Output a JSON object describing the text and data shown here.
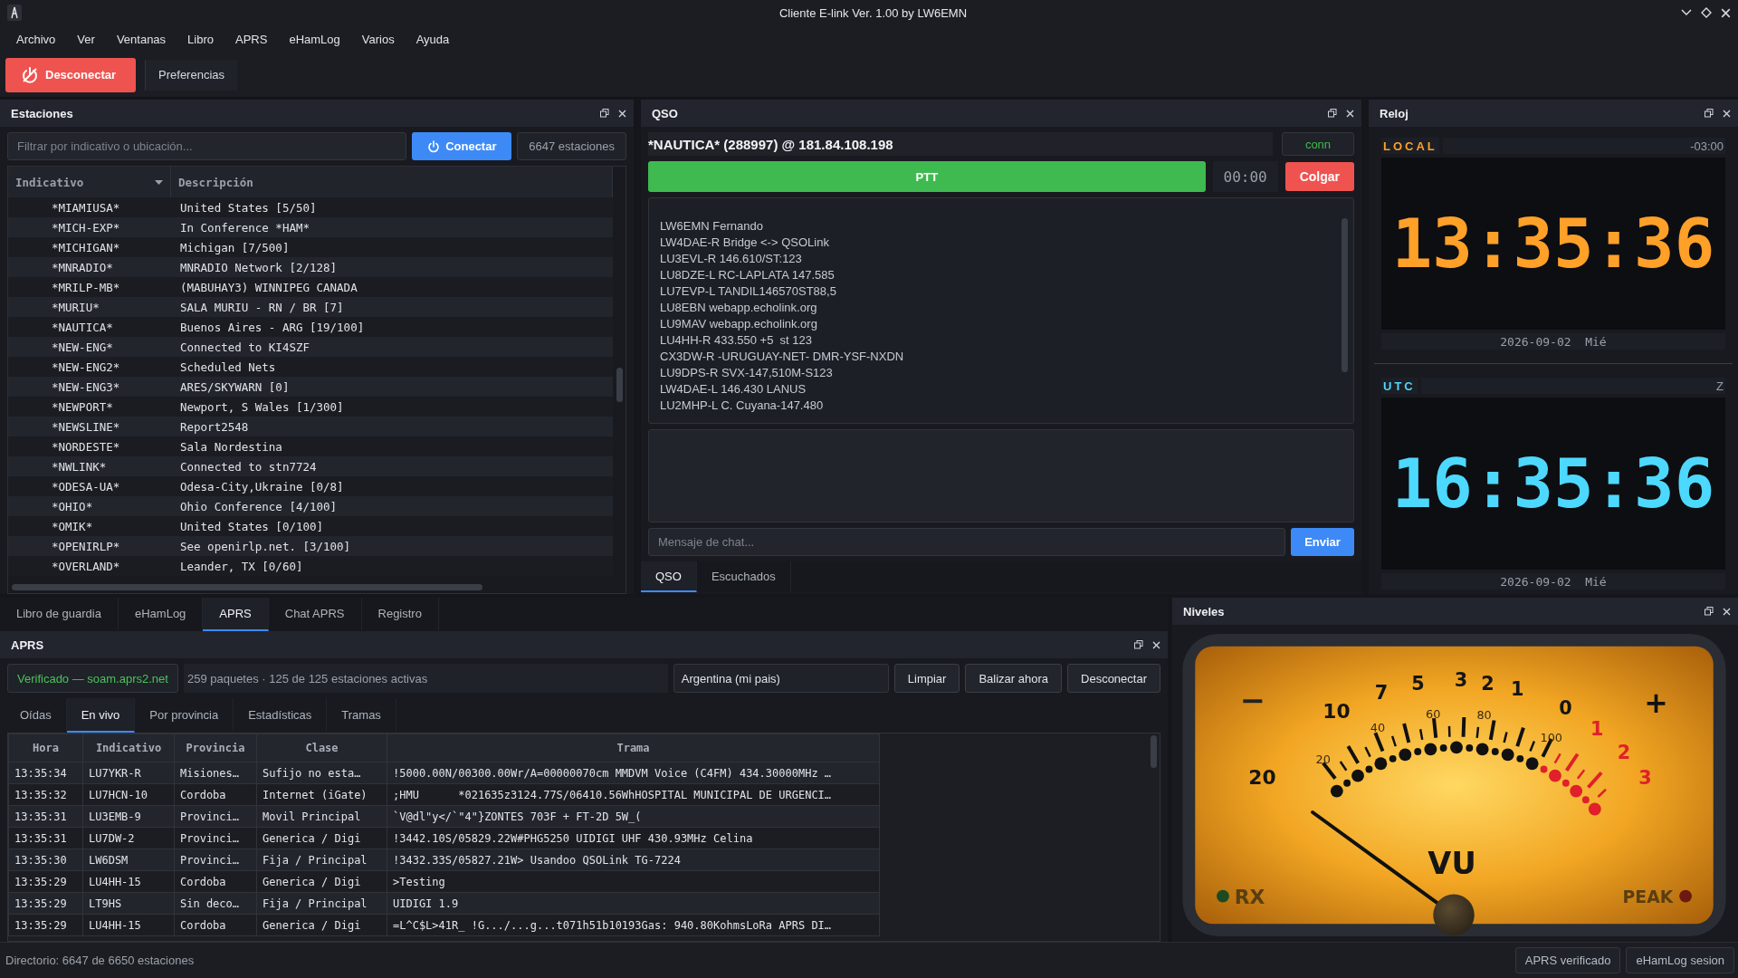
{
  "window": {
    "title": "Cliente E-link Ver. 1.00 by LW6EMN"
  },
  "menu": [
    "Archivo",
    "Ver",
    "Ventanas",
    "Libro",
    "APRS",
    "eHamLog",
    "Varios",
    "Ayuda"
  ],
  "toolbar": {
    "disconnect": "Desconectar",
    "preferences": "Preferencias"
  },
  "stations": {
    "title": "Estaciones",
    "filter_placeholder": "Filtrar por indicativo o ubicación...",
    "connect": "Conectar",
    "count": "6647 estaciones",
    "columns": [
      "Indicativo",
      "Descripción"
    ],
    "rows": [
      {
        "callsign": "*MIAMIUSA*",
        "description": "United States [5/50]"
      },
      {
        "callsign": "*MICH-EXP*",
        "description": "In Conference *HAM*"
      },
      {
        "callsign": "*MICHIGAN*",
        "description": "Michigan [7/500]"
      },
      {
        "callsign": "*MNRADIO*",
        "description": "MNRADIO Network [2/128]"
      },
      {
        "callsign": "*MRILP-MB*",
        "description": "(MABUHAY3) WINNIPEG CANADA"
      },
      {
        "callsign": "*MURIU*",
        "description": "SALA MURIU - RN / BR [7]"
      },
      {
        "callsign": "*NAUTICA*",
        "description": "Buenos Aires - ARG [19/100]"
      },
      {
        "callsign": "*NEW-ENG*",
        "description": "Connected to KI4SZF"
      },
      {
        "callsign": "*NEW-ENG2*",
        "description": "Scheduled Nets"
      },
      {
        "callsign": "*NEW-ENG3*",
        "description": "ARES/SKYWARN [0]"
      },
      {
        "callsign": "*NEWPORT*",
        "description": "Newport, S Wales [1/300]"
      },
      {
        "callsign": "*NEWSLINE*",
        "description": "Report2548"
      },
      {
        "callsign": "*NORDESTE*",
        "description": "Sala Nordestina"
      },
      {
        "callsign": "*NWLINK*",
        "description": "Connected to stn7724"
      },
      {
        "callsign": "*ODESA-UA*",
        "description": "Odesa-City,Ukraine [0/8]"
      },
      {
        "callsign": "*OHIO*",
        "description": "Ohio Conference [4/100]"
      },
      {
        "callsign": "*OMIK*",
        "description": "United States [0/100]"
      },
      {
        "callsign": "*OPENIRLP*",
        "description": "See openirlp.net. [3/100]"
      },
      {
        "callsign": "*OVERLAND*",
        "description": "Leander, TX [0/60]"
      }
    ]
  },
  "qso": {
    "title": "QSO",
    "station": "*NAUTICA* (288997) @ 181.84.108.198",
    "status": "conn",
    "connected": true,
    "ptt": "PTT",
    "timer": "00:00",
    "hangup": "Colgar",
    "participants": [
      "LW6EMN Fernando",
      "LW4DAE-R Bridge <-> QSOLink",
      "LU3EVL-R 146.610/ST:123",
      "LU8DZE-L RC-LAPLATA 147.585",
      "LU7EVP-L TANDIL146570ST88,5",
      "LU8EBN webapp.echolink.org",
      "LU9MAV webapp.echolink.org",
      "LU4HH-R 433.550 +5  st 123",
      "CX3DW-R -URUGUAY-NET- DMR-YSF-NXDN",
      "LU9DPS-R SVX-147,510M-S123",
      "LW4DAE-L 146.430 LANUS",
      "LU2MHP-L C. Cuyana-147.480"
    ],
    "chat_placeholder": "Mensaje de chat...",
    "send": "Enviar",
    "tabs": [
      {
        "label": "QSO",
        "selected": true
      },
      {
        "label": "Escuchados",
        "selected": false
      }
    ]
  },
  "clock": {
    "title": "Reloj",
    "clocks": [
      {
        "kind": "local",
        "label": "LOCAL",
        "offset": "-03:00",
        "time": "13:35:36",
        "date": "2026-09-02",
        "weekday": "Mié"
      },
      {
        "kind": "utc",
        "label": "UTC",
        "offset": "Z",
        "time": "16:35:36",
        "date": "2026-09-02",
        "weekday": "Mié"
      }
    ]
  },
  "bottom_tabs": [
    {
      "label": "Libro de guardia",
      "selected": false
    },
    {
      "label": "eHamLog",
      "selected": false
    },
    {
      "label": "APRS",
      "selected": true
    },
    {
      "label": "Chat APRS",
      "selected": false
    },
    {
      "label": "Registro",
      "selected": false
    }
  ],
  "aprs": {
    "title": "APRS",
    "server_status": "Verificado — soam.aprs2.net",
    "verified": true,
    "stats": "259 paquetes · 125 de 125 estaciones activas",
    "region": "Argentina (mi pais)",
    "buttons": [
      "Limpiar",
      "Balizar ahora",
      "Desconectar"
    ],
    "tabs": [
      {
        "label": "Oídas",
        "selected": false
      },
      {
        "label": "En vivo",
        "selected": true
      },
      {
        "label": "Por provincia",
        "selected": false
      },
      {
        "label": "Estadísticas",
        "selected": false
      },
      {
        "label": "Tramas",
        "selected": false
      }
    ],
    "table": {
      "columns": [
        "Hora",
        "Indicativo",
        "Provincia",
        "Clase",
        "Trama"
      ],
      "rows": [
        [
          "13:35:34",
          "LU7YKR-R",
          "Misiones…",
          "Sufijo no esta…",
          "!5000.00N/00300.00Wr/A=00000070cm MMDVM Voice (C4FM) 434.30000MHz …"
        ],
        [
          "13:35:32",
          "LU7HCN-10",
          "Cordoba",
          "Internet (iGate)",
          ";HMU      *021635z3124.77S/06410.56WhHOSPITAL MUNICIPAL DE URGENCI…"
        ],
        [
          "13:35:31",
          "LU3EMB-9",
          "Provinci…",
          "Movil Principal",
          "`V@dl\"y</`\"4\"}ZONTES 703F + FT-2D 5W_("
        ],
        [
          "13:35:31",
          "LU7DW-2",
          "Provinci…",
          "Generica / Digi",
          "!3442.10S/05829.22W#PHG5250 UIDIGI UHF 430.93MHz Celina"
        ],
        [
          "13:35:30",
          "LW6DSM",
          "Provinci…",
          "Fija / Principal",
          "!3432.33S/05827.21W> Usandoo QSOLink TG-7224"
        ],
        [
          "13:35:29",
          "LU4HH-15",
          "Cordoba",
          "Generica / Digi",
          ">Testing"
        ],
        [
          "13:35:29",
          "LT9HS",
          "Sin deco…",
          "Fija / Principal",
          "UIDIGI 1.9"
        ],
        [
          "13:35:29",
          "LU4HH-15",
          "Cordoba",
          "Generica / Digi",
          "=L^C$L>41R_ !G.../...g...t071h51b10193Gas: 940.80KohmsLoRa APRS DI…"
        ]
      ]
    }
  },
  "levels": {
    "title": "Niveles",
    "meter": {
      "minus": "−",
      "plus": "+",
      "db_labels": [
        "20",
        "10",
        "7",
        "5",
        "3",
        "2",
        "1",
        "0",
        "1",
        "2",
        "3"
      ],
      "percent_labels": [
        "20",
        "40",
        "60",
        "80",
        "100"
      ],
      "unit": "VU",
      "rx": {
        "label": "RX",
        "on": false
      },
      "peak": {
        "label": "PEAK",
        "on": false
      }
    }
  },
  "status_bar": {
    "text": "Directorio: 6647 de 6650 estaciones",
    "indicators": [
      "APRS verificado",
      "eHamLog sesion"
    ]
  }
}
